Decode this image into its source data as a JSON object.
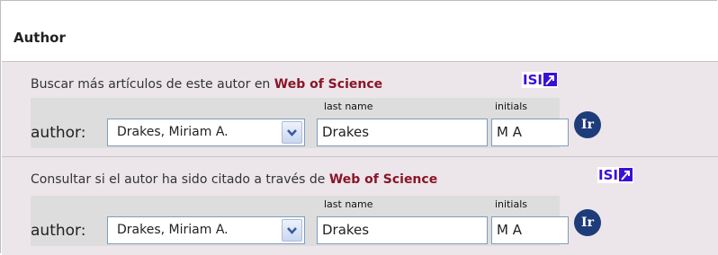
{
  "panel": {
    "title": "Author"
  },
  "sections": [
    {
      "intro_text": "Buscar más artículos de este autor en ",
      "intro_link": "Web of Science",
      "isi_logo": "ISI",
      "last_name_label": "last name",
      "initials_label": "initials",
      "author_label": "author:",
      "author_select_value": "Drakes, Miriam A.",
      "last_name_value": "Drakes",
      "initials_value": "M A",
      "go_button": "Ir"
    },
    {
      "intro_text": "Consultar si el autor ha sido citado a través de ",
      "intro_link": "Web of Science",
      "isi_logo": "ISI",
      "last_name_label": "last name",
      "initials_label": "initials",
      "author_label": "author:",
      "author_select_value": "Drakes, Miriam A.",
      "last_name_value": "Drakes",
      "initials_value": "M A",
      "go_button": "Ir"
    }
  ],
  "colors": {
    "wos_link": "#8a1528",
    "go_button": "#1e3c7a",
    "section_bg": "#ece6ea",
    "row_bg": "#dddddd"
  },
  "icons": {
    "dropdown": "chevron-down-icon",
    "isi": "isi-logo-icon"
  }
}
